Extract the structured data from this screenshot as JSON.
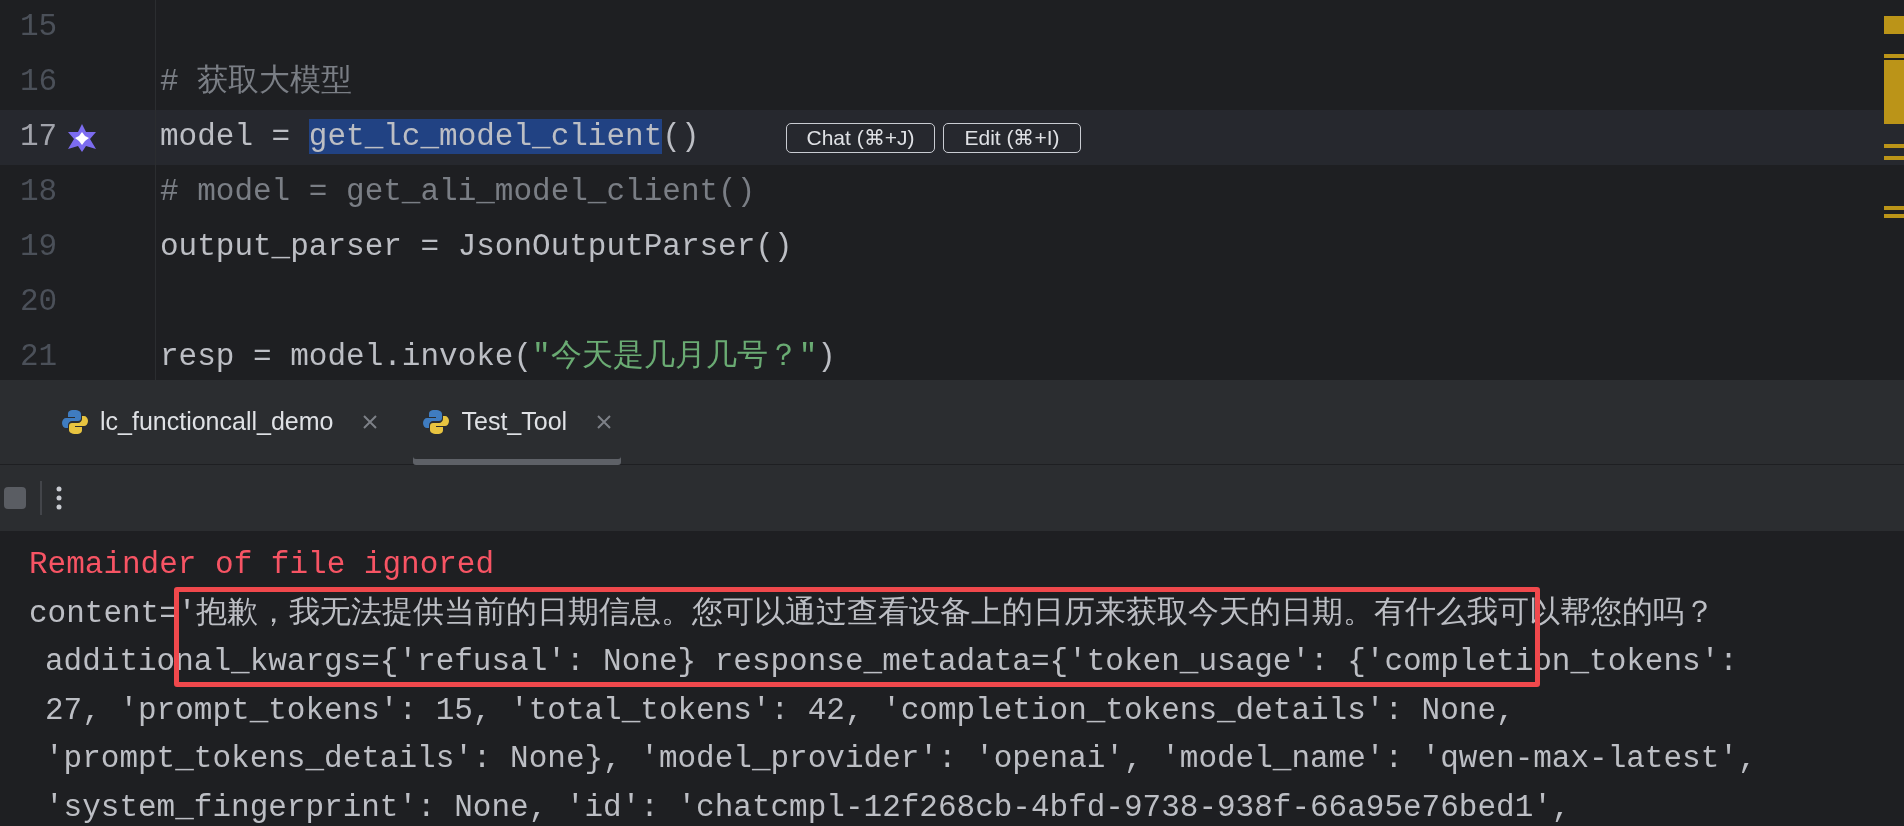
{
  "editor": {
    "lines": [
      {
        "number": "15",
        "current": false
      },
      {
        "number": "16",
        "current": false,
        "tokens": [
          {
            "kind": "comment",
            "text": "# 获取大模型"
          }
        ]
      },
      {
        "number": "17",
        "current": true,
        "ai_marker": true,
        "tokens": [
          {
            "kind": "plain",
            "text": "model = "
          },
          {
            "kind": "selected",
            "text": "get_lc_model_client"
          },
          {
            "kind": "plain",
            "text": "()"
          }
        ],
        "inline_actions": [
          "Chat (⌘+J)",
          "Edit (⌘+I)"
        ]
      },
      {
        "number": "18",
        "current": false,
        "tokens": [
          {
            "kind": "comment",
            "text": "# model = get_ali_model_client()"
          }
        ]
      },
      {
        "number": "19",
        "current": false,
        "tokens": [
          {
            "kind": "plain",
            "text": "output_parser = JsonOutputParser()"
          }
        ]
      },
      {
        "number": "20",
        "current": false
      },
      {
        "number": "21",
        "current": false,
        "tokens": [
          {
            "kind": "plain",
            "text": "resp = model.invoke("
          },
          {
            "kind": "string",
            "text": "\"今天是几月几号？\""
          },
          {
            "kind": "plain",
            "text": ")"
          }
        ]
      }
    ]
  },
  "run_tabs": [
    {
      "label": "lc_functioncall_demo",
      "selected": false
    },
    {
      "label": "Test_Tool",
      "selected": true
    }
  ],
  "output": {
    "lines": [
      {
        "kind": "error",
        "text": "Remainder of file ignored"
      },
      {
        "kind": "normal",
        "text": "content='抱歉，我无法提供当前的日期信息。您可以通过查看设备上的日历来获取今天的日期。有什么我可以帮您的吗？"
      },
      {
        "kind": "wrapped",
        "text": "additional_kwargs={'refusal': None} response_metadata={'token_usage': {'completion_tokens':"
      },
      {
        "kind": "wrapped",
        "text": "27, 'prompt_tokens': 15, 'total_tokens': 42, 'completion_tokens_details': None,"
      },
      {
        "kind": "wrapped",
        "text": "'prompt_tokens_details': None}, 'model_provider': 'openai', 'model_name': 'qwen-max-latest',"
      },
      {
        "kind": "wrapped",
        "text": "'system_fingerprint': None, 'id': 'chatcmpl-12f268cb-4bfd-9738-938f-66a95e76bed1',"
      }
    ]
  }
}
